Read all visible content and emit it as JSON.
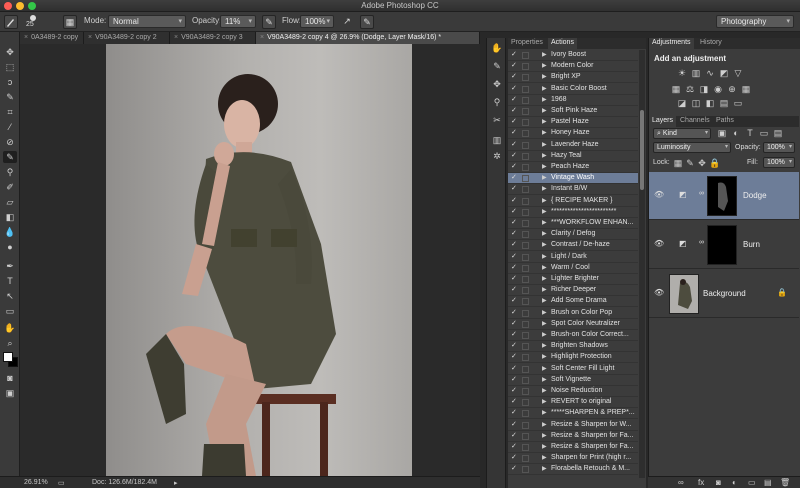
{
  "app": {
    "title": "Adobe Photoshop CC"
  },
  "options_bar": {
    "brush_size": "25",
    "mode_label": "Mode:",
    "mode_value": "Normal",
    "opacity_label": "Opacity:",
    "opacity_value": "11%",
    "flow_label": "Flow:",
    "flow_value": "100%",
    "workspace": "Photography"
  },
  "doc_tabs": [
    {
      "label": "0A3489-2 copy"
    },
    {
      "label": "V90A3489-2 copy 2"
    },
    {
      "label": "V90A3489-2 copy 3"
    },
    {
      "label": "V90A3489-2 copy 4 @ 26.9% (Dodge, Layer Mask/16) *"
    }
  ],
  "status": {
    "zoom": "26.91%",
    "doc": "Doc: 126.6M/182.4M"
  },
  "panel_tabs": {
    "properties": "Properties",
    "actions": "Actions",
    "adjustments": "Adjustments",
    "history": "History",
    "layers": "Layers",
    "channels": "Channels",
    "paths": "Paths"
  },
  "actions": [
    {
      "label": "Ivory Boost",
      "selected": false
    },
    {
      "label": "Modern Color",
      "selected": false
    },
    {
      "label": "Bright XP",
      "selected": false
    },
    {
      "label": "Basic Color Boost",
      "selected": false
    },
    {
      "label": "1968",
      "selected": false
    },
    {
      "label": "Soft Pink Haze",
      "selected": false
    },
    {
      "label": "Pastel Haze",
      "selected": false
    },
    {
      "label": "Honey Haze",
      "selected": false
    },
    {
      "label": "Lavender Haze",
      "selected": false
    },
    {
      "label": "Hazy Teal",
      "selected": false
    },
    {
      "label": "Peach Haze",
      "selected": false
    },
    {
      "label": "Vintage Wash",
      "selected": true
    },
    {
      "label": "Instant B/W",
      "selected": false
    },
    {
      "label": "{ RECIPE MAKER }",
      "selected": false
    },
    {
      "label": "************************",
      "selected": false
    },
    {
      "label": "***WORKFLOW ENHAN...",
      "selected": false
    },
    {
      "label": "Clarity / Defog",
      "selected": false
    },
    {
      "label": "Contrast / De-haze",
      "selected": false
    },
    {
      "label": "Light / Dark",
      "selected": false
    },
    {
      "label": "Warm / Cool",
      "selected": false
    },
    {
      "label": "Lighter Brighter",
      "selected": false
    },
    {
      "label": "Richer Deeper",
      "selected": false
    },
    {
      "label": "Add Some Drama",
      "selected": false
    },
    {
      "label": "Brush on Color Pop",
      "selected": false
    },
    {
      "label": "Spot Color Neutralizer",
      "selected": false
    },
    {
      "label": "Brush-on Color Correct...",
      "selected": false
    },
    {
      "label": "Brighten Shadows",
      "selected": false
    },
    {
      "label": "Highlight Protection",
      "selected": false
    },
    {
      "label": "Soft Center Fill Light",
      "selected": false
    },
    {
      "label": "Soft Vignette",
      "selected": false
    },
    {
      "label": "Noise Reduction",
      "selected": false
    },
    {
      "label": "REVERT to original",
      "selected": false
    },
    {
      "label": "*****SHARPEN & PREP*...",
      "selected": false
    },
    {
      "label": "Resize & Sharpen for W...",
      "selected": false
    },
    {
      "label": "Resize & Sharpen for Fa...",
      "selected": false
    },
    {
      "label": "Resize & Sharpen for Fa...",
      "selected": false
    },
    {
      "label": "Sharpen for Print (high r...",
      "selected": false
    },
    {
      "label": "Florabella Retouch & M...",
      "selected": false
    }
  ],
  "adjustments": {
    "title": "Add an adjustment"
  },
  "layers_panel": {
    "filter": "Kind",
    "blend_mode": "Luminosity",
    "opacity_label": "Opacity:",
    "opacity_value": "100%",
    "lock_label": "Lock:",
    "fill_label": "Fill:",
    "fill_value": "100%",
    "layers": [
      {
        "name": "Dodge",
        "selected": true
      },
      {
        "name": "Burn",
        "selected": false
      },
      {
        "name": "Background",
        "selected": false
      }
    ]
  },
  "colors": {
    "selection": "#6d7d98",
    "panel": "#3c3c3c",
    "dark": "#282828"
  }
}
